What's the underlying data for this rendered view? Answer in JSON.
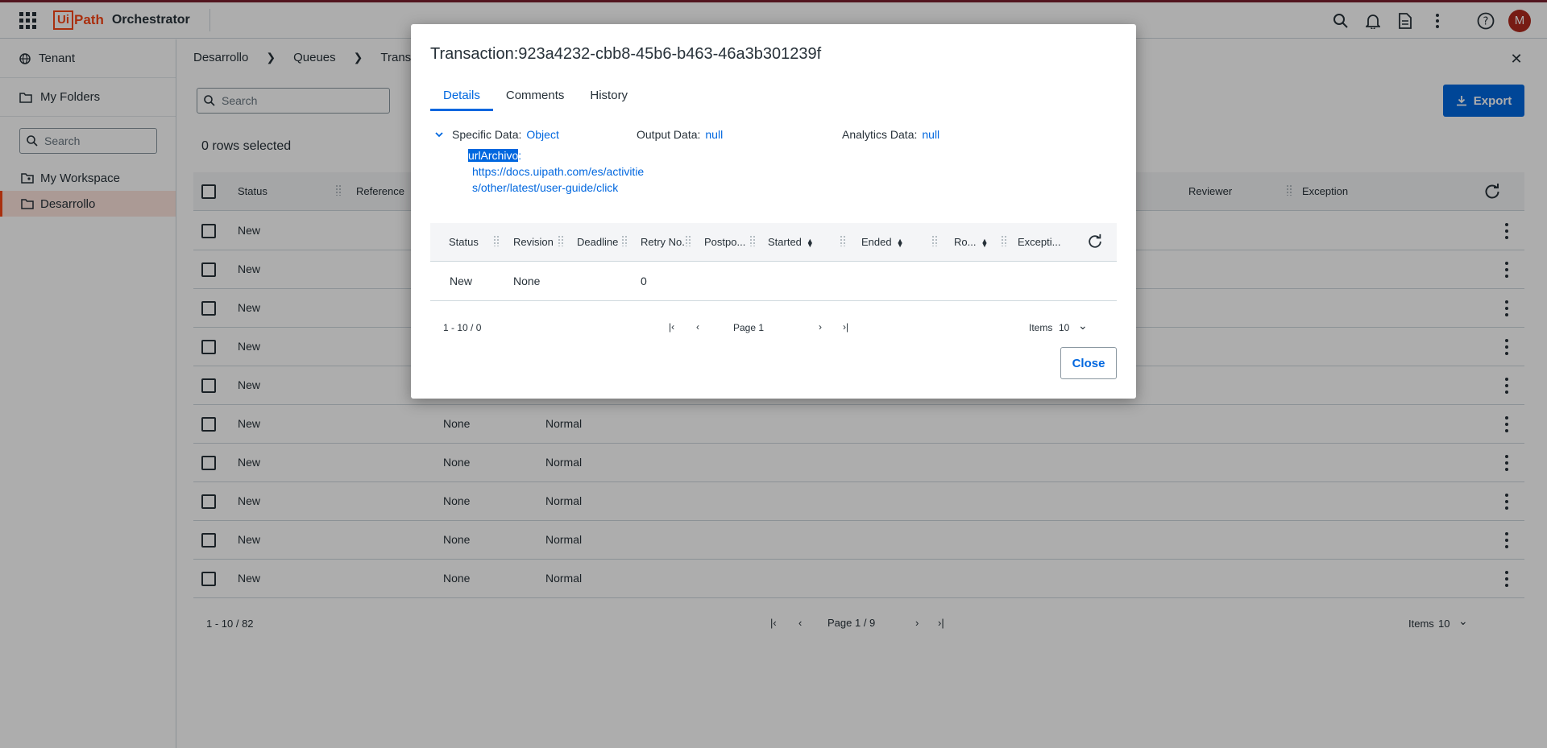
{
  "app": {
    "logo_box": "Ui",
    "logo_path": "Path",
    "product": "Orchestrator",
    "avatar_initial": "M"
  },
  "sidebar": {
    "tenant": "Tenant",
    "my_folders": "My Folders",
    "search_placeholder": "Search",
    "tree": [
      {
        "label": "My Workspace"
      },
      {
        "label": "Desarrollo"
      }
    ]
  },
  "main": {
    "breadcrumb": [
      "Desarrollo",
      "Queues",
      "Trans"
    ],
    "search_placeholder": "Search",
    "export_label": "Export",
    "rows_selected": "0 rows selected",
    "columns": {
      "status": "Status",
      "reference": "Reference",
      "reviewer": "Reviewer",
      "exception": "Exception"
    },
    "rows": [
      {
        "status": "New",
        "revision": "",
        "priority": ""
      },
      {
        "status": "New",
        "revision": "",
        "priority": ""
      },
      {
        "status": "New",
        "revision": "",
        "priority": ""
      },
      {
        "status": "New",
        "revision": "",
        "priority": ""
      },
      {
        "status": "New",
        "revision": "",
        "priority": ""
      },
      {
        "status": "New",
        "revision": "None",
        "priority": "Normal"
      },
      {
        "status": "New",
        "revision": "None",
        "priority": "Normal"
      },
      {
        "status": "New",
        "revision": "None",
        "priority": "Normal"
      },
      {
        "status": "New",
        "revision": "None",
        "priority": "Normal"
      },
      {
        "status": "New",
        "revision": "None",
        "priority": "Normal"
      }
    ],
    "pager": {
      "range": "1 - 10 / 82",
      "page": "Page 1 / 9",
      "items_label": "Items",
      "items_value": "10"
    }
  },
  "dialog": {
    "title": "Transaction:923a4232-cbb8-45b6-b463-46a3b301239f",
    "tabs": [
      "Details",
      "Comments",
      "History"
    ],
    "specific_data_label": "Specific Data:",
    "specific_data_value": "Object",
    "output_data_label": "Output Data:",
    "output_data_value": "null",
    "analytics_data_label": "Analytics Data:",
    "analytics_data_value": "null",
    "field_key": "urlArchivo",
    "field_colon": ":",
    "field_value": "https://docs.uipath.com/es/activities/other/latest/user-guide/click",
    "history_columns": [
      "Status",
      "Revision",
      "Deadline",
      "Retry No.",
      "Postpo...",
      "Started",
      "Ended",
      "Ro...",
      "Excepti..."
    ],
    "history_row": {
      "status": "New",
      "revision": "None",
      "retry": "0"
    },
    "pager": {
      "range": "1 - 10 / 0",
      "page": "Page 1",
      "items_label": "Items",
      "items_value": "10"
    },
    "close_label": "Close"
  },
  "colors": {
    "brand": "#fa4616",
    "accent": "#0067df",
    "overlay": "rgba(0,0,0,0.32)"
  }
}
